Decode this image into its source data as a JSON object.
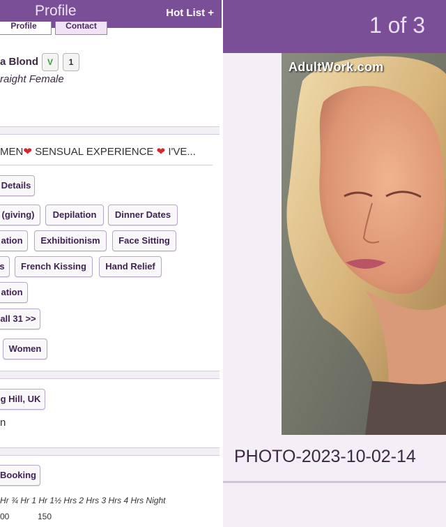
{
  "left": {
    "header": {
      "title": "Profile",
      "hot_list": "Hot List +"
    },
    "tabs": [
      "Profile",
      "Contact"
    ],
    "profile": {
      "name": "a Blond",
      "verified_badge": "V",
      "count_badge": "1",
      "orientation": "raight Female"
    },
    "headline": {
      "part1": "MEN",
      "part2": " SENSUAL EXPERIENCE ",
      "part3": " I'VE..."
    },
    "details_button": "Details",
    "services": [
      "(giving)",
      "Depilation",
      "Dinner Dates",
      "ation",
      "Exhibitionism",
      "Face Sitting",
      "s",
      "French Kissing",
      "Hand Relief",
      "ation"
    ],
    "view_all": "all 31 >>",
    "preference": "Women",
    "location_button": "g Hill, UK",
    "location_line": "n",
    "booking_button": "Booking",
    "durations": [
      "Hr",
      "¾ Hr",
      "1 Hr",
      "1½ Hrs",
      "2 Hrs",
      "3 Hrs",
      "4 Hrs",
      "Night"
    ],
    "prices": [
      "00",
      "150"
    ]
  },
  "right": {
    "counter": "1 of 3",
    "watermark": "AdultWork.com",
    "caption": "PHOTO-2023-10-02-14"
  },
  "colors": {
    "brand_purple": "#7b4f98",
    "heart_red": "#d8262c",
    "verified_green": "#3f9a3f"
  }
}
